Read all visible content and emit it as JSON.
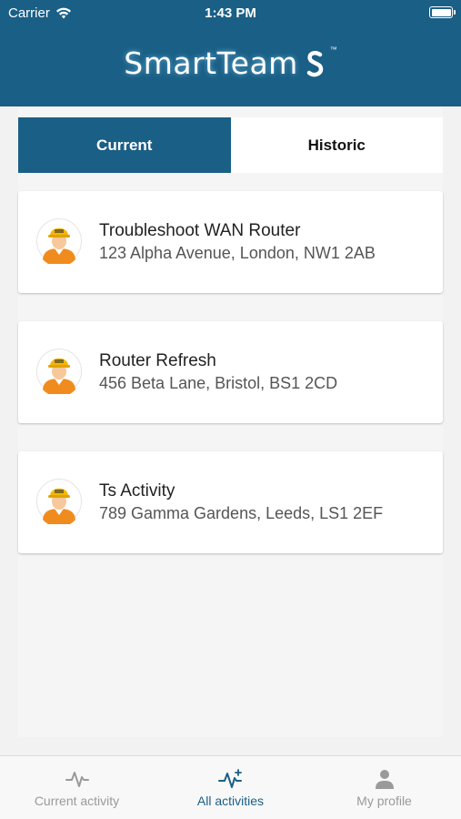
{
  "status_bar": {
    "carrier": "Carrier",
    "time": "1:43 PM"
  },
  "header": {
    "logo_text": "SmartTeam",
    "logo_tm": "™"
  },
  "tabs": [
    {
      "label": "Current",
      "active": true
    },
    {
      "label": "Historic",
      "active": false
    }
  ],
  "activities": [
    {
      "title": "Troubleshoot WAN Router",
      "address": "123 Alpha Avenue, London, NW1 2AB"
    },
    {
      "title": "Router Refresh",
      "address": "456 Beta Lane, Bristol, BS1 2CD"
    },
    {
      "title": "Ts Activity",
      "address": "789 Gamma Gardens, Leeds, LS1 2EF"
    }
  ],
  "tab_bar": [
    {
      "label": "Current activity",
      "icon": "activity-icon",
      "active": false
    },
    {
      "label": "All activities",
      "icon": "activity-plus-icon",
      "active": true
    },
    {
      "label": "My profile",
      "icon": "person-icon",
      "active": false
    }
  ],
  "colors": {
    "brand": "#1a5f86",
    "helmet": "#f5b700",
    "vest": "#f08c1e"
  }
}
